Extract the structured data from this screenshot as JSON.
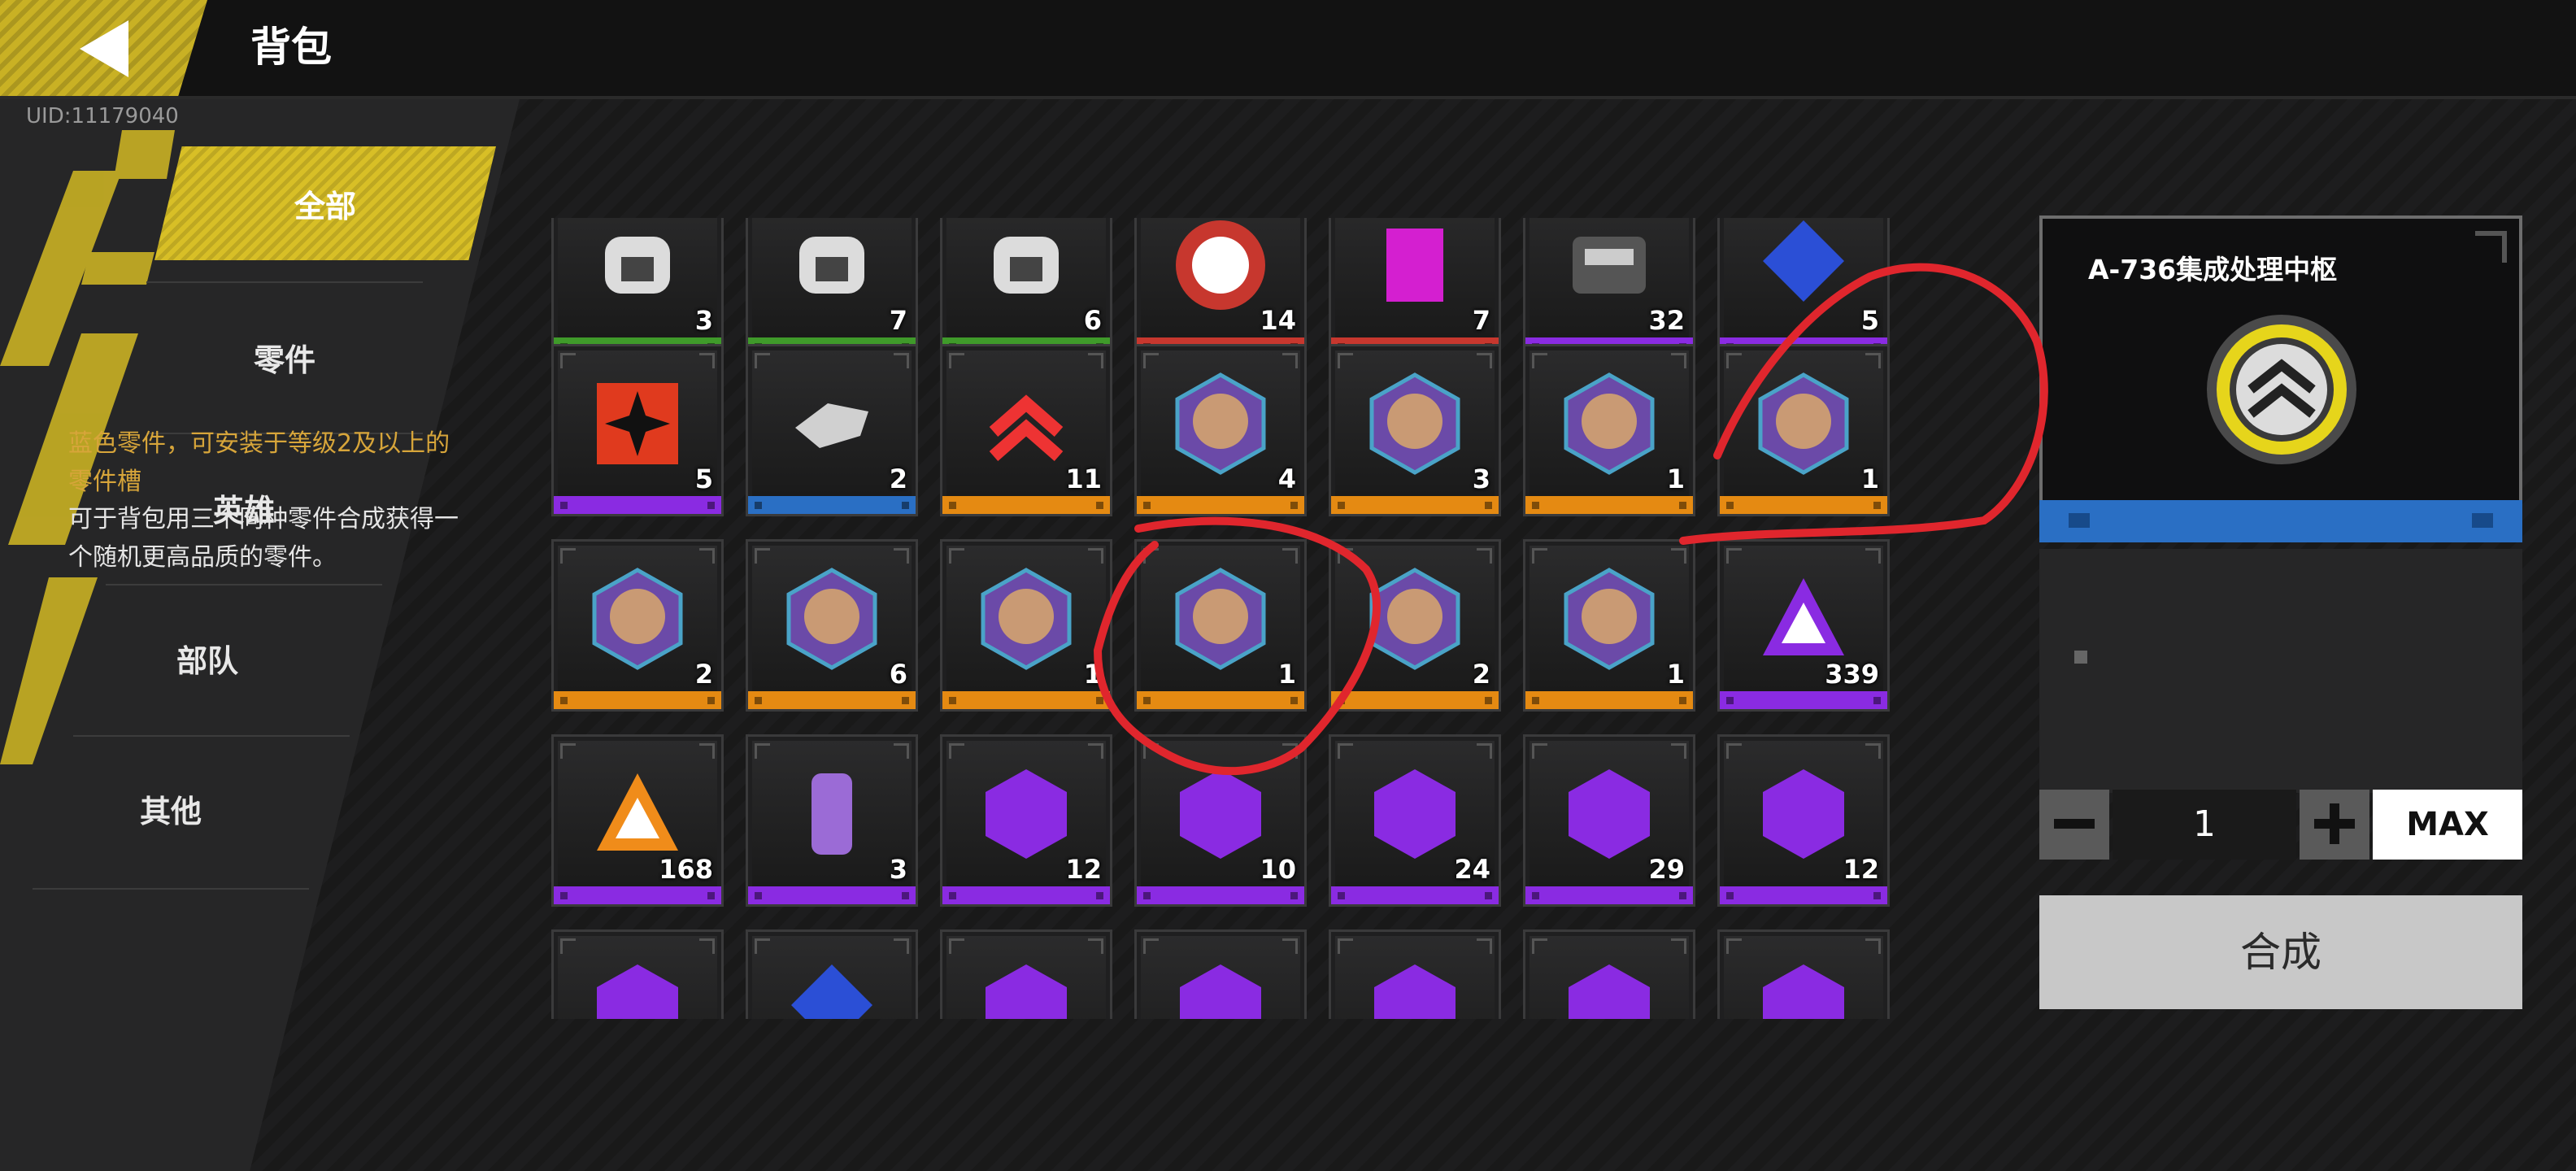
{
  "header": {
    "title": "背包"
  },
  "uid": "UID:11179040",
  "nav": {
    "all": "全部",
    "parts": "零件",
    "heroes": "英雄",
    "troops": "部队",
    "others": "其他"
  },
  "colors": {
    "accent": "#d8bf26",
    "green": "#3f9a2a",
    "red": "#c7372e",
    "purple": "#8a2be2",
    "blue": "#2a6fc4",
    "orange": "#e58a12",
    "annotation": "#e0262d"
  },
  "grid": {
    "rows": [
      [
        {
          "icon": "robot-part-icon",
          "count": "3",
          "rarity": "green"
        },
        {
          "icon": "robot-part-icon",
          "count": "7",
          "rarity": "green"
        },
        {
          "icon": "robot-part-icon",
          "count": "6",
          "rarity": "green"
        },
        {
          "icon": "eagle-emblem-icon",
          "count": "14",
          "rarity": "red"
        },
        {
          "icon": "magenta-part-icon",
          "count": "7",
          "rarity": "red"
        },
        {
          "icon": "parts-box-icon",
          "count": "32",
          "rarity": "purple"
        },
        {
          "icon": "blue-emblem-icon",
          "count": "5",
          "rarity": "purple"
        }
      ],
      [
        {
          "icon": "star-banner-icon",
          "count": "5",
          "rarity": "purple"
        },
        {
          "icon": "blaster-part-icon",
          "count": "2",
          "rarity": "blue"
        },
        {
          "icon": "chevron-rank-icon",
          "count": "11",
          "rarity": "orange"
        },
        {
          "icon": "hero-portrait-icon",
          "count": "4",
          "rarity": "orange"
        },
        {
          "icon": "hero-portrait-icon",
          "count": "3",
          "rarity": "orange"
        },
        {
          "icon": "hero-portrait-icon",
          "count": "1",
          "rarity": "orange"
        },
        {
          "icon": "hero-portrait-icon",
          "count": "1",
          "rarity": "orange"
        }
      ],
      [
        {
          "icon": "hero-portrait-icon",
          "count": "2",
          "rarity": "orange"
        },
        {
          "icon": "hero-portrait-icon",
          "count": "6",
          "rarity": "orange"
        },
        {
          "icon": "hero-portrait-icon",
          "count": "1",
          "rarity": "orange"
        },
        {
          "icon": "hero-portrait-icon",
          "count": "1",
          "rarity": "orange"
        },
        {
          "icon": "hero-portrait-icon",
          "count": "2",
          "rarity": "orange"
        },
        {
          "icon": "hero-portrait-icon",
          "count": "1",
          "rarity": "orange"
        },
        {
          "icon": "purple-triangle-icon",
          "count": "339",
          "rarity": "purple"
        }
      ],
      [
        {
          "icon": "orange-triangle-icon",
          "count": "168",
          "rarity": "purple"
        },
        {
          "icon": "canister-icon",
          "count": "3",
          "rarity": "purple"
        },
        {
          "icon": "troop-badge-icon",
          "count": "12",
          "rarity": "purple"
        },
        {
          "icon": "troop-badge-icon",
          "count": "10",
          "rarity": "purple"
        },
        {
          "icon": "troop-badge-icon",
          "count": "24",
          "rarity": "purple"
        },
        {
          "icon": "troop-badge-icon",
          "count": "29",
          "rarity": "purple"
        },
        {
          "icon": "troop-badge-icon",
          "count": "12",
          "rarity": "purple"
        }
      ],
      [
        {
          "icon": "troop-badge-icon",
          "count": "",
          "rarity": "purple"
        },
        {
          "icon": "blue-emblem-icon",
          "count": "",
          "rarity": "blue"
        },
        {
          "icon": "troop-badge-icon",
          "count": "",
          "rarity": "blue"
        },
        {
          "icon": "troop-badge-icon",
          "count": "",
          "rarity": "blue"
        },
        {
          "icon": "troop-badge-icon",
          "count": "",
          "rarity": "blue"
        },
        {
          "icon": "troop-badge-icon",
          "count": "",
          "rarity": "blue"
        },
        {
          "icon": "troop-badge-icon",
          "count": "",
          "rarity": "blue"
        }
      ]
    ]
  },
  "detail": {
    "name": "A-736集成处理中枢",
    "desc_quality": "蓝色零件，可安装于等级2及以上的零件槽",
    "desc_combine": "可于背包用三个同种零件合成获得一个随机更高品质的零件。",
    "quantity": "1",
    "max_label": "MAX",
    "compose_label": "合成"
  }
}
